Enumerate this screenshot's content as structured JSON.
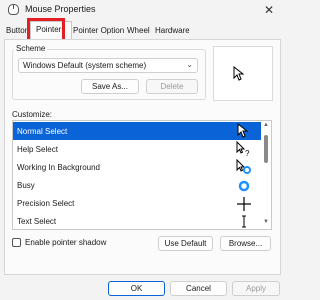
{
  "window": {
    "title": "Mouse Properties",
    "close_glyph": "✕"
  },
  "tabs": [
    {
      "label": "Buttons",
      "active": false
    },
    {
      "label": "Pointers",
      "active": true
    },
    {
      "label": "Pointer Options",
      "active": false
    },
    {
      "label": "Wheel",
      "active": false
    },
    {
      "label": "Hardware",
      "active": false
    }
  ],
  "scheme": {
    "label": "Scheme",
    "selected": "Windows Default (system scheme)",
    "save_as": "Save As...",
    "delete": "Delete"
  },
  "customize": {
    "label": "Customize:",
    "rows": [
      {
        "label": "Normal Select",
        "icon": "arrow-cursor-icon",
        "selected": true
      },
      {
        "label": "Help Select",
        "icon": "help-cursor-icon",
        "selected": false
      },
      {
        "label": "Working In Background",
        "icon": "working-cursor-icon",
        "selected": false
      },
      {
        "label": "Busy",
        "icon": "busy-cursor-icon",
        "selected": false
      },
      {
        "label": "Precision Select",
        "icon": "crosshair-cursor-icon",
        "selected": false
      },
      {
        "label": "Text Select",
        "icon": "text-cursor-icon",
        "selected": false
      }
    ]
  },
  "shadow": {
    "label": "Enable pointer shadow",
    "checked": false
  },
  "buttons": {
    "use_default": "Use Default",
    "browse": "Browse...",
    "ok": "OK",
    "cancel": "Cancel",
    "apply": "Apply"
  },
  "colors": {
    "accent": "#0a64d8",
    "highlight_box": "#e31e24",
    "busy_ring": "#1e90ff"
  }
}
